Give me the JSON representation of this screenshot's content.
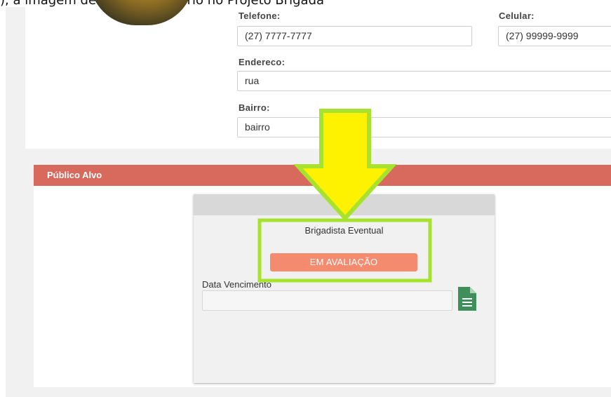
{
  "header_fragment": {
    "text": "), a imagem de Perfil do Usuário no Projeto Brigada"
  },
  "contact": {
    "telefone": {
      "label": "Telefone:",
      "value": "(27) 7777-7777"
    },
    "celular": {
      "label": "Celular:",
      "value": "(27) 99999-9999"
    },
    "endereco": {
      "label": "Endereco:",
      "value": "rua"
    },
    "bairro": {
      "label": "Bairro:",
      "value": "bairro"
    }
  },
  "publico_alvo": {
    "title": "Público Alvo",
    "card": {
      "name": "Brigadista Eventual",
      "status": "EM AVALIAÇÃO",
      "due_date_label": "Data Vencimento",
      "due_date_value": "",
      "document_icon": "document-icon"
    }
  },
  "colors": {
    "section_header": "#d76a5d",
    "status_button": "#f58b6e",
    "document_icon": "#3f8f5a",
    "arrow_fill": "#fff200",
    "highlight_border": "#a7e22e"
  }
}
